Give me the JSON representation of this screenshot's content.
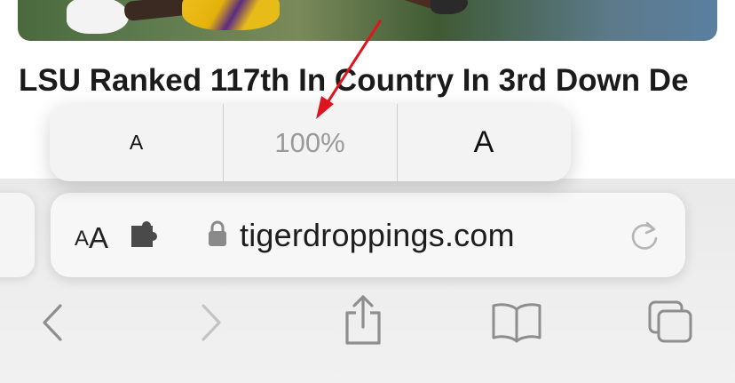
{
  "article": {
    "headline": "LSU Ranked 117th In Country In 3rd Down De"
  },
  "text_size_popover": {
    "decrease_label": "A",
    "zoom_level": "100%",
    "increase_label": "A"
  },
  "address_bar": {
    "aa_small": "A",
    "aa_large": "A",
    "url": "tigerdroppings.com"
  },
  "icons": {
    "extension": "puzzle-piece-icon",
    "lock": "lock-icon",
    "reload": "reload-icon",
    "back": "chevron-left-icon",
    "forward": "chevron-right-icon",
    "share": "share-icon",
    "bookmarks": "book-icon",
    "tabs": "tabs-icon"
  },
  "colors": {
    "annotation_arrow": "#e0141e",
    "zoom_text": "#9a9a9a",
    "disabled_icon": "#a8a8a8",
    "toolbar_icon": "#8e8e8e"
  }
}
